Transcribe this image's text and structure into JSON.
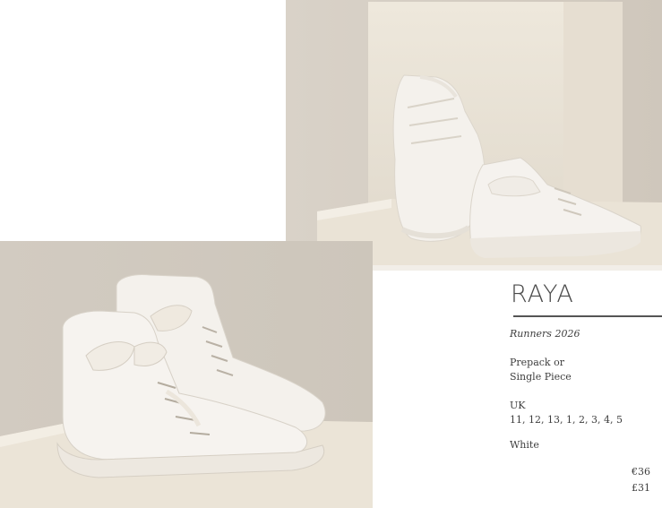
{
  "product": {
    "name": "RAYA",
    "collection": "Runners 2026",
    "pack_line1": "Prepack or",
    "pack_line2": "Single Piece",
    "size_label": "UK",
    "sizes": "11, 12, 13, 1, 2, 3, 4, 5",
    "colour": "White",
    "price_eur": "€36",
    "price_gbp": "£31"
  }
}
